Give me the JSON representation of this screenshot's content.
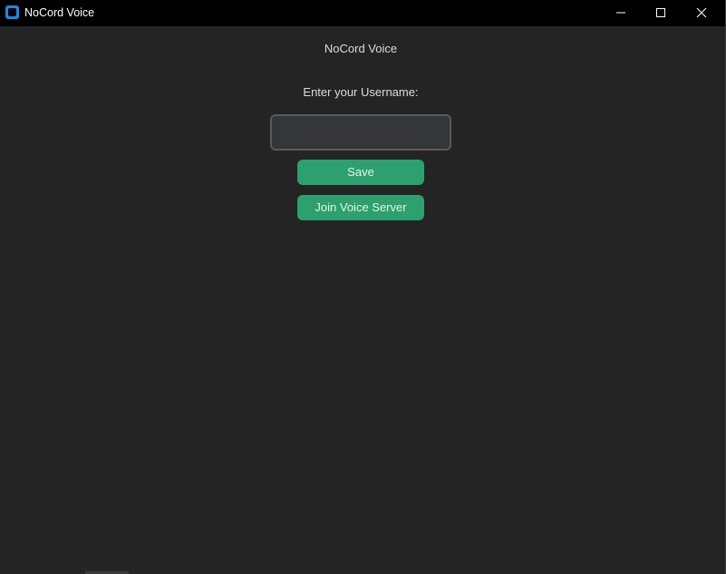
{
  "window": {
    "title": "NoCord Voice",
    "icon": "app-icon",
    "controls": [
      "minimize-icon",
      "maximize-icon",
      "close-icon"
    ]
  },
  "main": {
    "heading": "NoCord Voice",
    "prompt": "Enter your Username:",
    "username": {
      "value": "",
      "placeholder": ""
    },
    "save_label": "Save",
    "join_label": "Join Voice Server"
  },
  "colors": {
    "background": "#242424",
    "titlebar": "#000000",
    "accent": "#2ca06f",
    "input_bg": "#343638",
    "input_border": "#565b5e",
    "app_icon": "#1e88e5"
  }
}
